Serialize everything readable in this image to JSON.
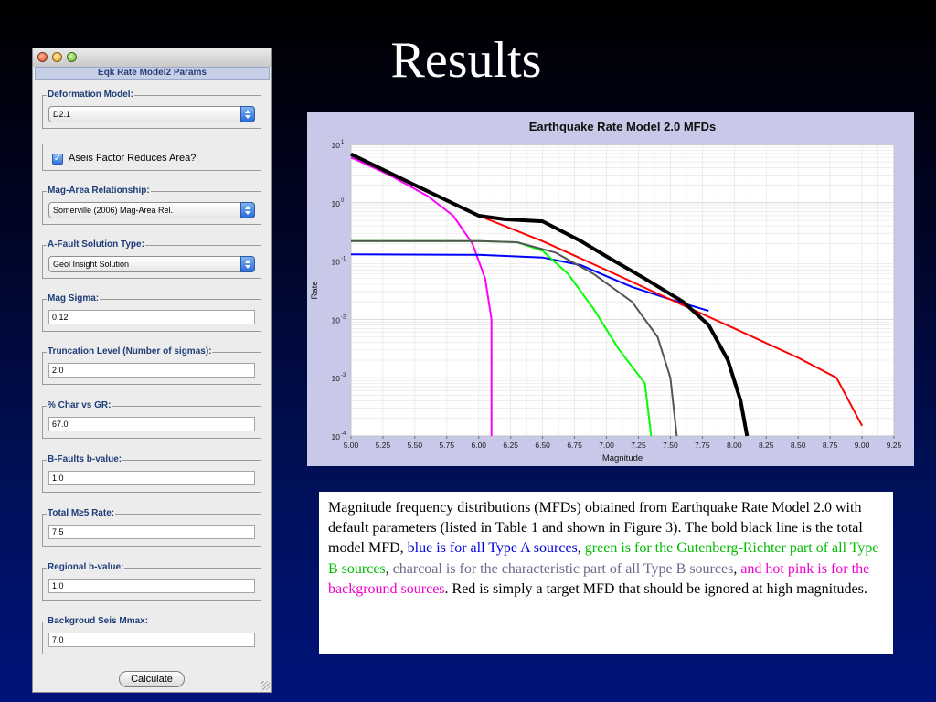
{
  "slide": {
    "title": "Results"
  },
  "window": {
    "title": "Eqk Rate Model2 Params",
    "groups": [
      {
        "label": "Deformation Model:",
        "kind": "combo",
        "value": "D2.1"
      },
      {
        "label": "",
        "kind": "checkbox",
        "value": "Aseis Factor Reduces Area?",
        "checked": true
      },
      {
        "label": "Mag-Area Relationship:",
        "kind": "combo",
        "value": "Somerville (2006) Mag-Area Rel."
      },
      {
        "label": "A-Fault Solution Type:",
        "kind": "combo",
        "value": "Geol Insight Solution"
      },
      {
        "label": "Mag Sigma:",
        "kind": "field",
        "value": "0.12"
      },
      {
        "label": "Truncation Level (Number of sigmas):",
        "kind": "field",
        "value": "2.0"
      },
      {
        "label": "% Char vs GR:",
        "kind": "field",
        "value": "67.0"
      },
      {
        "label": "B-Faults b-value:",
        "kind": "field",
        "value": "1.0"
      },
      {
        "label": "Total M≥5 Rate:",
        "kind": "field",
        "value": "7.5"
      },
      {
        "label": "Regional b-value:",
        "kind": "field",
        "value": "1.0"
      },
      {
        "label": "Backgroud Seis Mmax:",
        "kind": "field",
        "value": "7.0"
      }
    ],
    "calculate_label": "Calculate"
  },
  "chart_data": {
    "type": "line",
    "title": "Earthquake Rate Model 2.0 MFDs",
    "xlabel": "Magnitude",
    "ylabel": "Rate",
    "xlim": [
      5.0,
      9.25
    ],
    "ylim_log10": [
      -4,
      1
    ],
    "yscale": "log",
    "grid": true,
    "x_ticks": [
      "5.00",
      "5.25",
      "5.50",
      "5.75",
      "6.00",
      "6.25",
      "6.50",
      "6.75",
      "7.00",
      "7.25",
      "7.50",
      "7.75",
      "8.00",
      "8.25",
      "8.50",
      "8.75",
      "9.00",
      "9.25"
    ],
    "y_ticks": [
      {
        "base": "10",
        "exp": "1"
      },
      {
        "base": "10",
        "exp": "0"
      },
      {
        "base": "10",
        "exp": "-1"
      },
      {
        "base": "10",
        "exp": "-2"
      },
      {
        "base": "10",
        "exp": "-3"
      },
      {
        "base": "10",
        "exp": "-4"
      }
    ],
    "series": [
      {
        "color": "#ff00ff",
        "width": 2,
        "points": [
          [
            5.0,
            6.0
          ],
          [
            5.3,
            3.0
          ],
          [
            5.6,
            1.3
          ],
          [
            5.8,
            0.6
          ],
          [
            5.95,
            0.2
          ],
          [
            6.05,
            0.05
          ],
          [
            6.1,
            0.01
          ],
          [
            6.1,
            0.0001
          ]
        ]
      },
      {
        "color": "#0000ff",
        "width": 2,
        "points": [
          [
            5.0,
            0.13
          ],
          [
            6.0,
            0.128
          ],
          [
            6.5,
            0.115
          ],
          [
            6.8,
            0.085
          ],
          [
            7.0,
            0.055
          ],
          [
            7.2,
            0.036
          ],
          [
            7.5,
            0.022
          ],
          [
            7.8,
            0.014
          ]
        ]
      },
      {
        "color": "#00ff00",
        "width": 2,
        "points": [
          [
            5.0,
            0.22
          ],
          [
            6.0,
            0.22
          ],
          [
            6.3,
            0.21
          ],
          [
            6.5,
            0.15
          ],
          [
            6.7,
            0.06
          ],
          [
            6.9,
            0.015
          ],
          [
            7.1,
            0.003
          ],
          [
            7.3,
            0.0008
          ],
          [
            7.35,
            0.0001
          ]
        ]
      },
      {
        "color": "#555555",
        "width": 2,
        "points": [
          [
            5.0,
            0.22
          ],
          [
            6.0,
            0.22
          ],
          [
            6.3,
            0.21
          ],
          [
            6.6,
            0.14
          ],
          [
            6.9,
            0.06
          ],
          [
            7.2,
            0.02
          ],
          [
            7.4,
            0.005
          ],
          [
            7.5,
            0.001
          ],
          [
            7.55,
            0.0001
          ]
        ]
      },
      {
        "color": "#ff0000",
        "width": 2,
        "points": [
          [
            5.0,
            6.8
          ],
          [
            5.5,
            2.0
          ],
          [
            6.0,
            0.6
          ],
          [
            6.5,
            0.22
          ],
          [
            7.0,
            0.07
          ],
          [
            7.5,
            0.022
          ],
          [
            8.0,
            0.007
          ],
          [
            8.5,
            0.0022
          ],
          [
            8.8,
            0.001
          ],
          [
            9.0,
            0.00015
          ]
        ]
      },
      {
        "color": "#000000",
        "width": 4,
        "points": [
          [
            5.0,
            6.8
          ],
          [
            5.5,
            2.0
          ],
          [
            6.0,
            0.6
          ],
          [
            6.2,
            0.52
          ],
          [
            6.5,
            0.48
          ],
          [
            6.8,
            0.22
          ],
          [
            7.0,
            0.12
          ],
          [
            7.3,
            0.05
          ],
          [
            7.6,
            0.02
          ],
          [
            7.8,
            0.008
          ],
          [
            7.95,
            0.002
          ],
          [
            8.05,
            0.0004
          ],
          [
            8.1,
            0.0001
          ]
        ]
      }
    ]
  },
  "caption": {
    "part1": "Magnitude frequency distributions (MFDs) obtained from Earthquake Rate Model 2.0 with default parameters (listed in Table 1 and shown in Figure 3).  The bold black line is the total model MFD, ",
    "blue": "blue is for all Type A sources",
    "sep1": ", ",
    "green": "green is for the Gutenberg-Richter part of all Type B sources",
    "sep2": ", ",
    "gray": "charcoal is for the characteristic part of all Type B sources",
    "sep3": ", ",
    "pink": "and hot pink is for the background sources",
    "part2": ".  Red is simply a target MFD that should be ignored at high magnitudes."
  }
}
